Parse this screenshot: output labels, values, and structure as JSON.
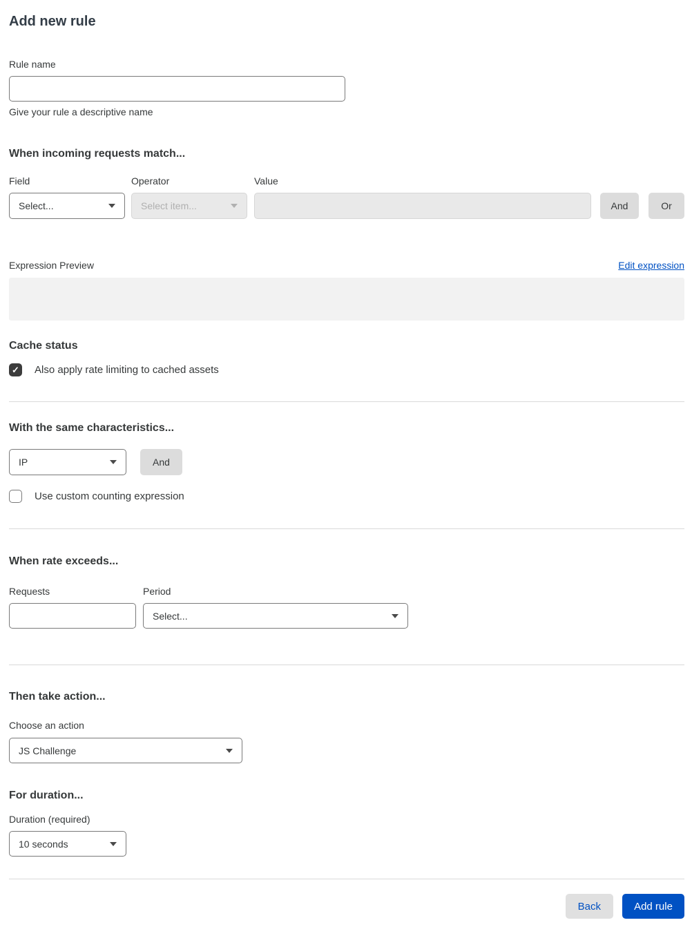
{
  "page": {
    "title": "Add new rule"
  },
  "rule_name": {
    "label": "Rule name",
    "value": "",
    "helper": "Give your rule a descriptive name"
  },
  "match": {
    "heading": "When incoming requests match...",
    "field_label": "Field",
    "field_value": "Select...",
    "operator_label": "Operator",
    "operator_value": "Select item...",
    "operator_disabled": true,
    "value_label": "Value",
    "value_value": "",
    "value_disabled": true,
    "and_label": "And",
    "or_label": "Or"
  },
  "expression": {
    "label": "Expression Preview",
    "edit_link": "Edit expression",
    "content": ""
  },
  "cache": {
    "heading": "Cache status",
    "checkbox_label": "Also apply rate limiting to cached assets",
    "checked": true
  },
  "characteristics": {
    "heading": "With the same characteristics...",
    "value": "IP",
    "and_label": "And",
    "custom_counting_label": "Use custom counting expression",
    "custom_counting_checked": false
  },
  "rate": {
    "heading": "When rate exceeds...",
    "requests_label": "Requests",
    "requests_value": "",
    "period_label": "Period",
    "period_value": "Select..."
  },
  "action": {
    "heading": "Then take action...",
    "choose_label": "Choose an action",
    "value": "JS Challenge"
  },
  "duration": {
    "heading": "For duration...",
    "label": "Duration (required)",
    "value": "10 seconds"
  },
  "footer": {
    "back_label": "Back",
    "add_rule_label": "Add rule"
  },
  "icons": {
    "chevron_down": "css-triangle-down",
    "checkmark": "✓"
  },
  "colors": {
    "accent_blue": "#0051c3",
    "checkbox_checked": "#3c3c3c",
    "disabled_bg": "#e9e9e9",
    "preview_bg": "#f2f2f2",
    "divider": "#d9d9d9",
    "gray_button_bg": "#dcdcdc",
    "text": "#36393a"
  }
}
